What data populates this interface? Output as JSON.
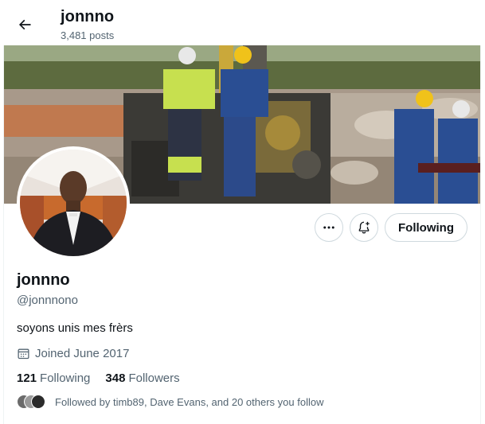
{
  "header": {
    "name": "jonnno",
    "posts": "3,481 posts"
  },
  "actions": {
    "follow_label": "Following"
  },
  "profile": {
    "display_name": "jonnno",
    "handle": "@jonnnono",
    "bio": "soyons unis mes frèrs",
    "joined": "Joined June 2017",
    "following_count": "121",
    "following_label": "Following",
    "followers_count": "348",
    "followers_label": "Followers",
    "followed_by": "Followed by timb89, Dave Evans, and 20 others you follow"
  },
  "icons": {
    "back": "arrow-left-icon",
    "more": "more-icon",
    "notify": "bell-plus-icon",
    "calendar": "calendar-icon"
  }
}
